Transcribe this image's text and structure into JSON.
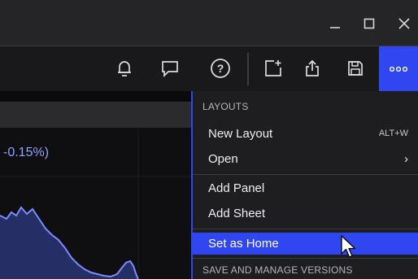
{
  "menu": {
    "sections": {
      "layouts": "LAYOUTS",
      "versions": "SAVE AND MANAGE VERSIONS"
    },
    "items": {
      "new_layout": {
        "label": "New Layout",
        "shortcut": "ALT+W"
      },
      "open": {
        "label": "Open",
        "arrow": "›"
      },
      "add_panel": {
        "label": "Add Panel"
      },
      "add_sheet": {
        "label": "Add Sheet"
      },
      "set_as_home": {
        "label": "Set as Home"
      }
    }
  },
  "panel": {
    "change_text": "-0.15%)"
  },
  "colors": {
    "accent": "#2f46f0",
    "chart_line": "#7a8cff",
    "chart_fill": "#2a3470"
  },
  "icons": [
    "minimize-icon",
    "maximize-icon",
    "close-icon",
    "bell-icon",
    "chat-icon",
    "help-icon",
    "new-panel-icon",
    "share-icon",
    "save-icon",
    "more-icon",
    "cursor-icon"
  ]
}
